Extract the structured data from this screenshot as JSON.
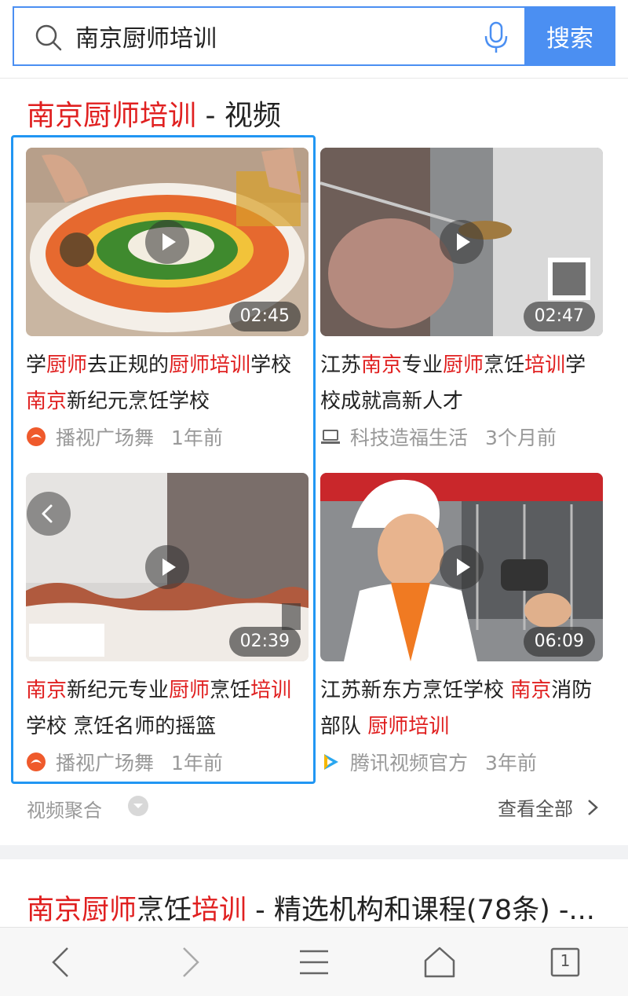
{
  "search": {
    "query": "南京厨师培训",
    "button_label": "搜索"
  },
  "video_section": {
    "title_query": "南京厨师培训",
    "title_suffix": " - 视频",
    "cards": [
      {
        "title_parts": [
          {
            "t": "学",
            "hl": false
          },
          {
            "t": "厨师",
            "hl": true
          },
          {
            "t": "去正规的",
            "hl": false
          },
          {
            "t": "厨师培训",
            "hl": true
          },
          {
            "t": "学校 ",
            "hl": false
          },
          {
            "t": "南京",
            "hl": true
          },
          {
            "t": "新纪元烹饪学校",
            "hl": false
          }
        ],
        "duration": "02:45",
        "source": "播视广场舞",
        "time": "1年前",
        "source_icon": "bosi-logo-icon"
      },
      {
        "title_parts": [
          {
            "t": "江苏",
            "hl": false
          },
          {
            "t": "南京",
            "hl": true
          },
          {
            "t": "专业",
            "hl": false
          },
          {
            "t": "厨师",
            "hl": true
          },
          {
            "t": "烹饪",
            "hl": false
          },
          {
            "t": "培训",
            "hl": true
          },
          {
            "t": "学校成就高新人才",
            "hl": false
          }
        ],
        "duration": "02:47",
        "source": "科技造福生活",
        "time": "3个月前",
        "source_icon": "laptop-icon"
      },
      {
        "title_parts": [
          {
            "t": "南京",
            "hl": true
          },
          {
            "t": "新纪元专业",
            "hl": false
          },
          {
            "t": "厨师",
            "hl": true
          },
          {
            "t": "烹饪",
            "hl": false
          },
          {
            "t": "培训",
            "hl": true
          },
          {
            "t": "学校 烹饪名师的摇篮",
            "hl": false
          }
        ],
        "duration": "02:39",
        "source": "播视广场舞",
        "time": "1年前",
        "source_icon": "bosi-logo-icon"
      },
      {
        "title_parts": [
          {
            "t": "江苏新东方烹饪学校 ",
            "hl": false
          },
          {
            "t": "南京",
            "hl": true
          },
          {
            "t": "消防部队 ",
            "hl": false
          },
          {
            "t": "厨师培训",
            "hl": true
          }
        ],
        "duration": "06:09",
        "source": "腾讯视频官方",
        "time": "3年前",
        "source_icon": "tencent-video-icon"
      }
    ],
    "aggregate_label": "视频聚合",
    "view_all_label": "查看全部"
  },
  "result2": {
    "title_parts": [
      {
        "t": "南京厨师",
        "hl": true
      },
      {
        "t": "烹饪",
        "hl": false
      },
      {
        "t": "培训",
        "hl": true
      },
      {
        "t": " - 精选机构和课程(78条) -...",
        "hl": false
      }
    ]
  },
  "bottom_nav": {
    "tab_count": "1"
  },
  "colors": {
    "accent": "#4b8ff2",
    "highlight": "#e02020",
    "selection_frame": "#2196f3"
  }
}
